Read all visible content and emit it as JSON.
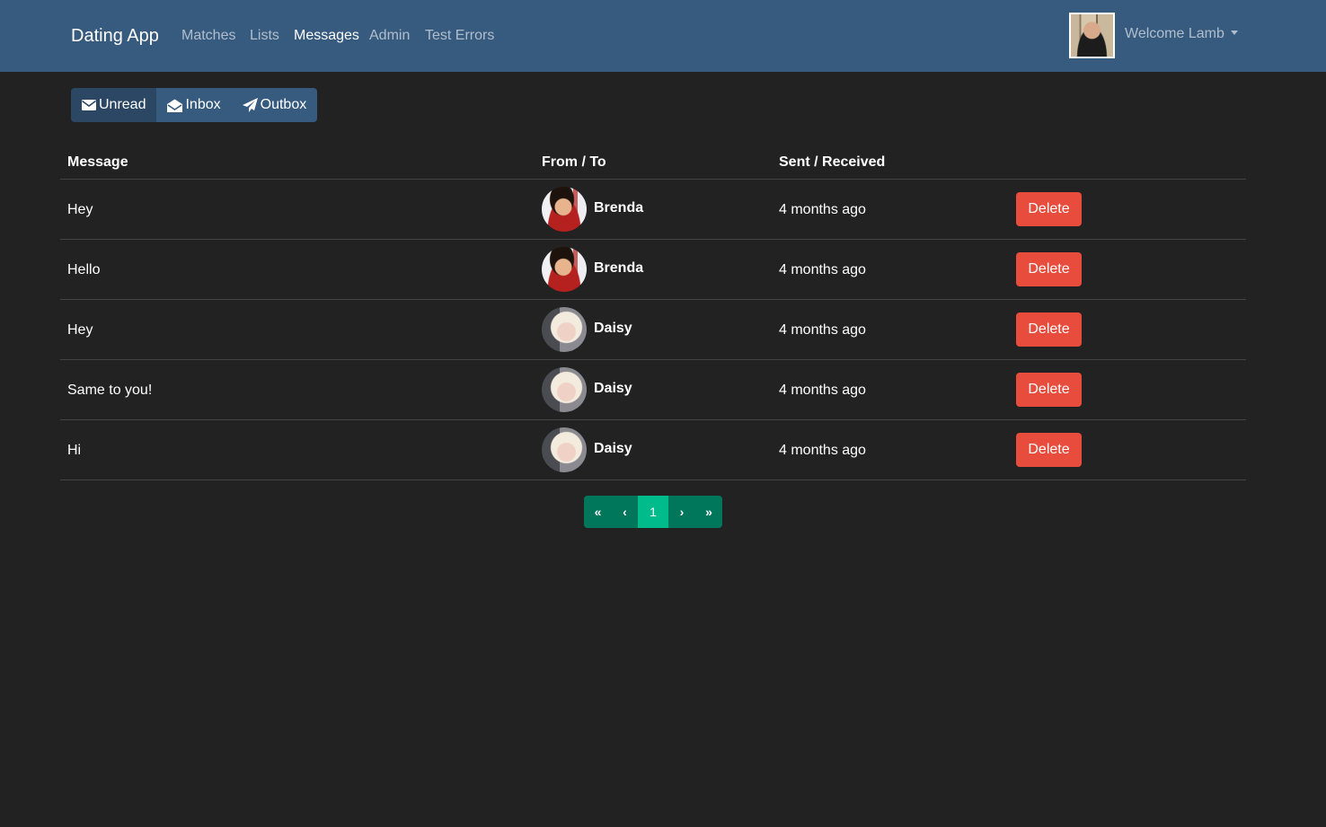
{
  "navbar": {
    "brand": "Dating App",
    "links": [
      {
        "label": "Matches",
        "active": false
      },
      {
        "label": "Lists",
        "active": false
      },
      {
        "label": "Messages",
        "active": true
      },
      {
        "label": "Admin",
        "active": false
      },
      {
        "label": "Test Errors",
        "active": false
      }
    ],
    "welcome": "Welcome Lamb",
    "user_menu_icon": "caret-down-icon"
  },
  "container_tabs": [
    {
      "label": "Unread",
      "icon": "envelope-icon",
      "active": true
    },
    {
      "label": "Inbox",
      "icon": "envelope-open-icon",
      "active": false
    },
    {
      "label": "Outbox",
      "icon": "paper-plane-icon",
      "active": false
    }
  ],
  "table": {
    "headers": {
      "message": "Message",
      "from_to": "From / To",
      "sent_received": "Sent / Received"
    },
    "rows": [
      {
        "content": "Hey",
        "user": "Brenda",
        "time": "4 months ago",
        "action": "Delete"
      },
      {
        "content": "Hello",
        "user": "Brenda",
        "time": "4 months ago",
        "action": "Delete"
      },
      {
        "content": "Hey",
        "user": "Daisy",
        "time": "4 months ago",
        "action": "Delete"
      },
      {
        "content": "Same to you!",
        "user": "Daisy",
        "time": "4 months ago",
        "action": "Delete"
      },
      {
        "content": "Hi",
        "user": "Daisy",
        "time": "4 months ago",
        "action": "Delete"
      }
    ]
  },
  "pagination": {
    "first": "«",
    "prev": "‹",
    "pages": [
      "1"
    ],
    "current": "1",
    "next": "›",
    "last": "»"
  },
  "colors": {
    "navbar": "#375a7f",
    "background": "#222222",
    "danger": "#e74c3c",
    "success": "#00bc8c",
    "success_dark": "#00775a"
  }
}
